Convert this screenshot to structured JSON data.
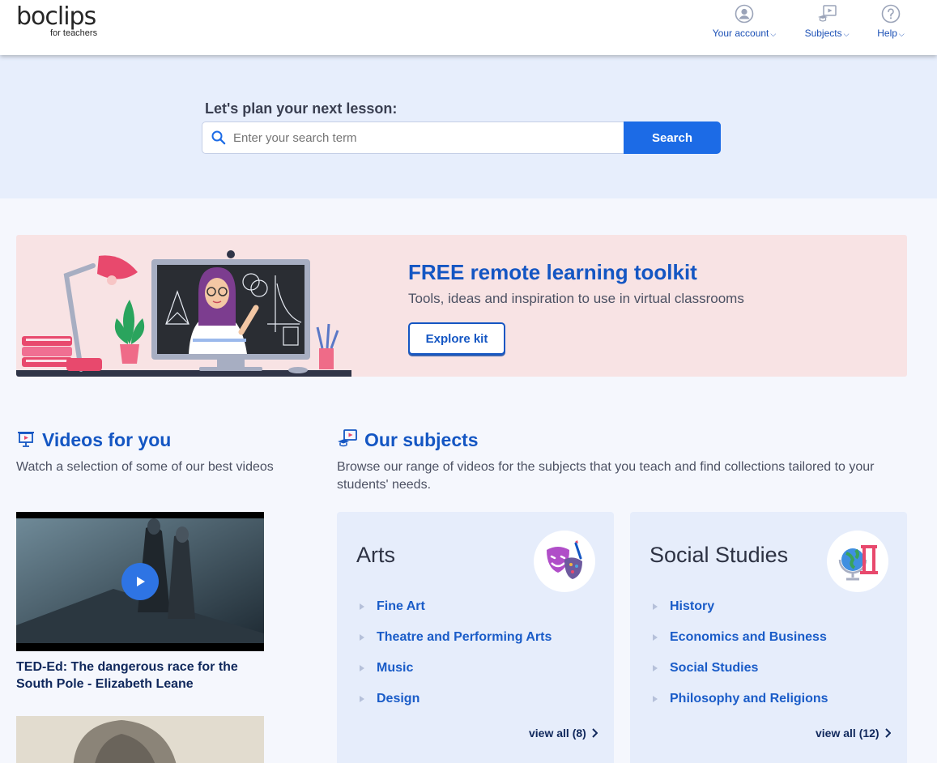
{
  "header": {
    "logo_main": "boclips",
    "logo_sub": "for teachers",
    "nav": [
      {
        "label": "Your account",
        "icon": "user-icon"
      },
      {
        "label": "Subjects",
        "icon": "subjects-icon"
      },
      {
        "label": "Help",
        "icon": "help-icon"
      }
    ]
  },
  "hero": {
    "title": "Let's plan your next lesson:",
    "search_placeholder": "Enter your search term",
    "search_button": "Search"
  },
  "banner": {
    "title": "FREE remote learning toolkit",
    "subtitle": "Tools, ideas and inspiration to use in virtual classrooms",
    "button": "Explore kit"
  },
  "videos": {
    "title": "Videos for you",
    "description": "Watch a selection of some of our best videos",
    "items": [
      {
        "title": "TED-Ed: The dangerous race for the South Pole - Elizabeth Leane"
      }
    ]
  },
  "subjects": {
    "title": "Our subjects",
    "description": "Browse our range of videos for the subjects that you teach and find collections tailored to your students' needs.",
    "cards": [
      {
        "name": "Arts",
        "icon": "theatre-masks-icon",
        "items": [
          "Fine Art",
          "Theatre and Performing Arts",
          "Music",
          "Design"
        ],
        "view_all": "view all (8)"
      },
      {
        "name": "Social Studies",
        "icon": "globe-column-icon",
        "items": [
          "History",
          "Economics and Business",
          "Social Studies",
          "Philosophy and Religions"
        ],
        "view_all": "view all (12)"
      }
    ]
  },
  "colors": {
    "brand_blue": "#1456c3",
    "search_button": "#1c6be6",
    "banner_bg": "#f8e3e4",
    "hero_bg": "#e7eefc"
  }
}
